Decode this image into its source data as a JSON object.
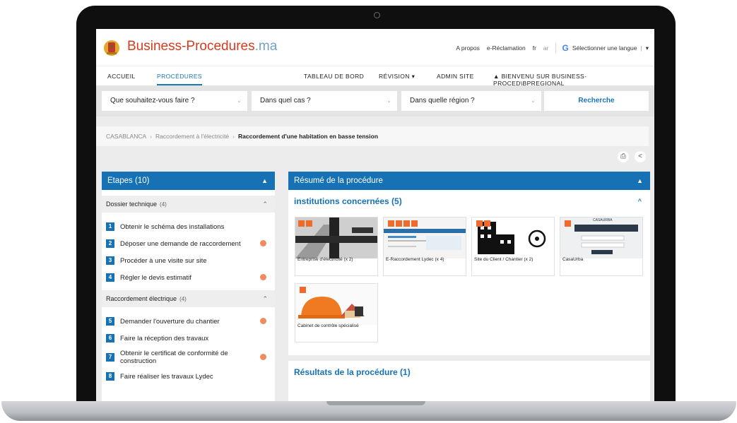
{
  "header": {
    "brand_main": "Business-Procedures",
    "brand_tld": ".ma",
    "links": [
      "A propos",
      "e-Réclamation",
      "fr",
      "ar"
    ],
    "language_select": "Sélectionner une langue"
  },
  "nav": {
    "items": [
      "ACCUEIL",
      "PROCÉDURES",
      "TABLEAU DE BORD",
      "RÉVISION",
      "ADMIN SITE",
      "BIENVENU SUR BUSINESS-PROCED\\BPREGIONAL"
    ],
    "active": "PROCÉDURES"
  },
  "search": {
    "what": "Que souhaitez-vous faire ?",
    "case": "Dans quel cas ?",
    "region": "Dans quelle région ?",
    "button": "Recherche"
  },
  "breadcrumb": [
    "CASABLANCA",
    "Raccordement à l'électricité",
    "Raccordement d'une habitation en basse tension"
  ],
  "steps_panel": {
    "title": "Etapes (10)",
    "groups": [
      {
        "label": "Dossier technique",
        "count": "(4)",
        "steps": [
          {
            "n": "1",
            "label": "Obtenir le schéma des installations"
          },
          {
            "n": "2",
            "label": "Déposer une demande de raccordement"
          },
          {
            "n": "3",
            "label": "Procéder à une visite sur site"
          },
          {
            "n": "4",
            "label": "Régler le devis estimatif"
          }
        ]
      },
      {
        "label": "Raccordement électrique",
        "count": "(4)",
        "steps": [
          {
            "n": "5",
            "label": "Demander l'ouverture du chantier"
          },
          {
            "n": "6",
            "label": "Faire la réception des travaux"
          },
          {
            "n": "7",
            "label": "Obtenir le certificat de conformité de construction"
          },
          {
            "n": "8",
            "label": "Faire réaliser les travaux Lydec"
          }
        ]
      }
    ]
  },
  "summary_panel": {
    "title": "Résumé de la procédure",
    "institutions_title": "institutions concernées (5)",
    "institutions": [
      "Entreprise d'électricité (x 2)",
      "E-Raccordement Lydec (x 4)",
      "Site du Client / Chantier (x 2)",
      "CasaUrba",
      "Cabinet de contrôle spécialisé"
    ],
    "casaurba_banner": "CASAURBA",
    "results_title": "Résultats de la procédure (1)"
  },
  "colors": {
    "accent": "#1672b5",
    "brand": "#d63b1f",
    "badge": "#f06a2b"
  }
}
